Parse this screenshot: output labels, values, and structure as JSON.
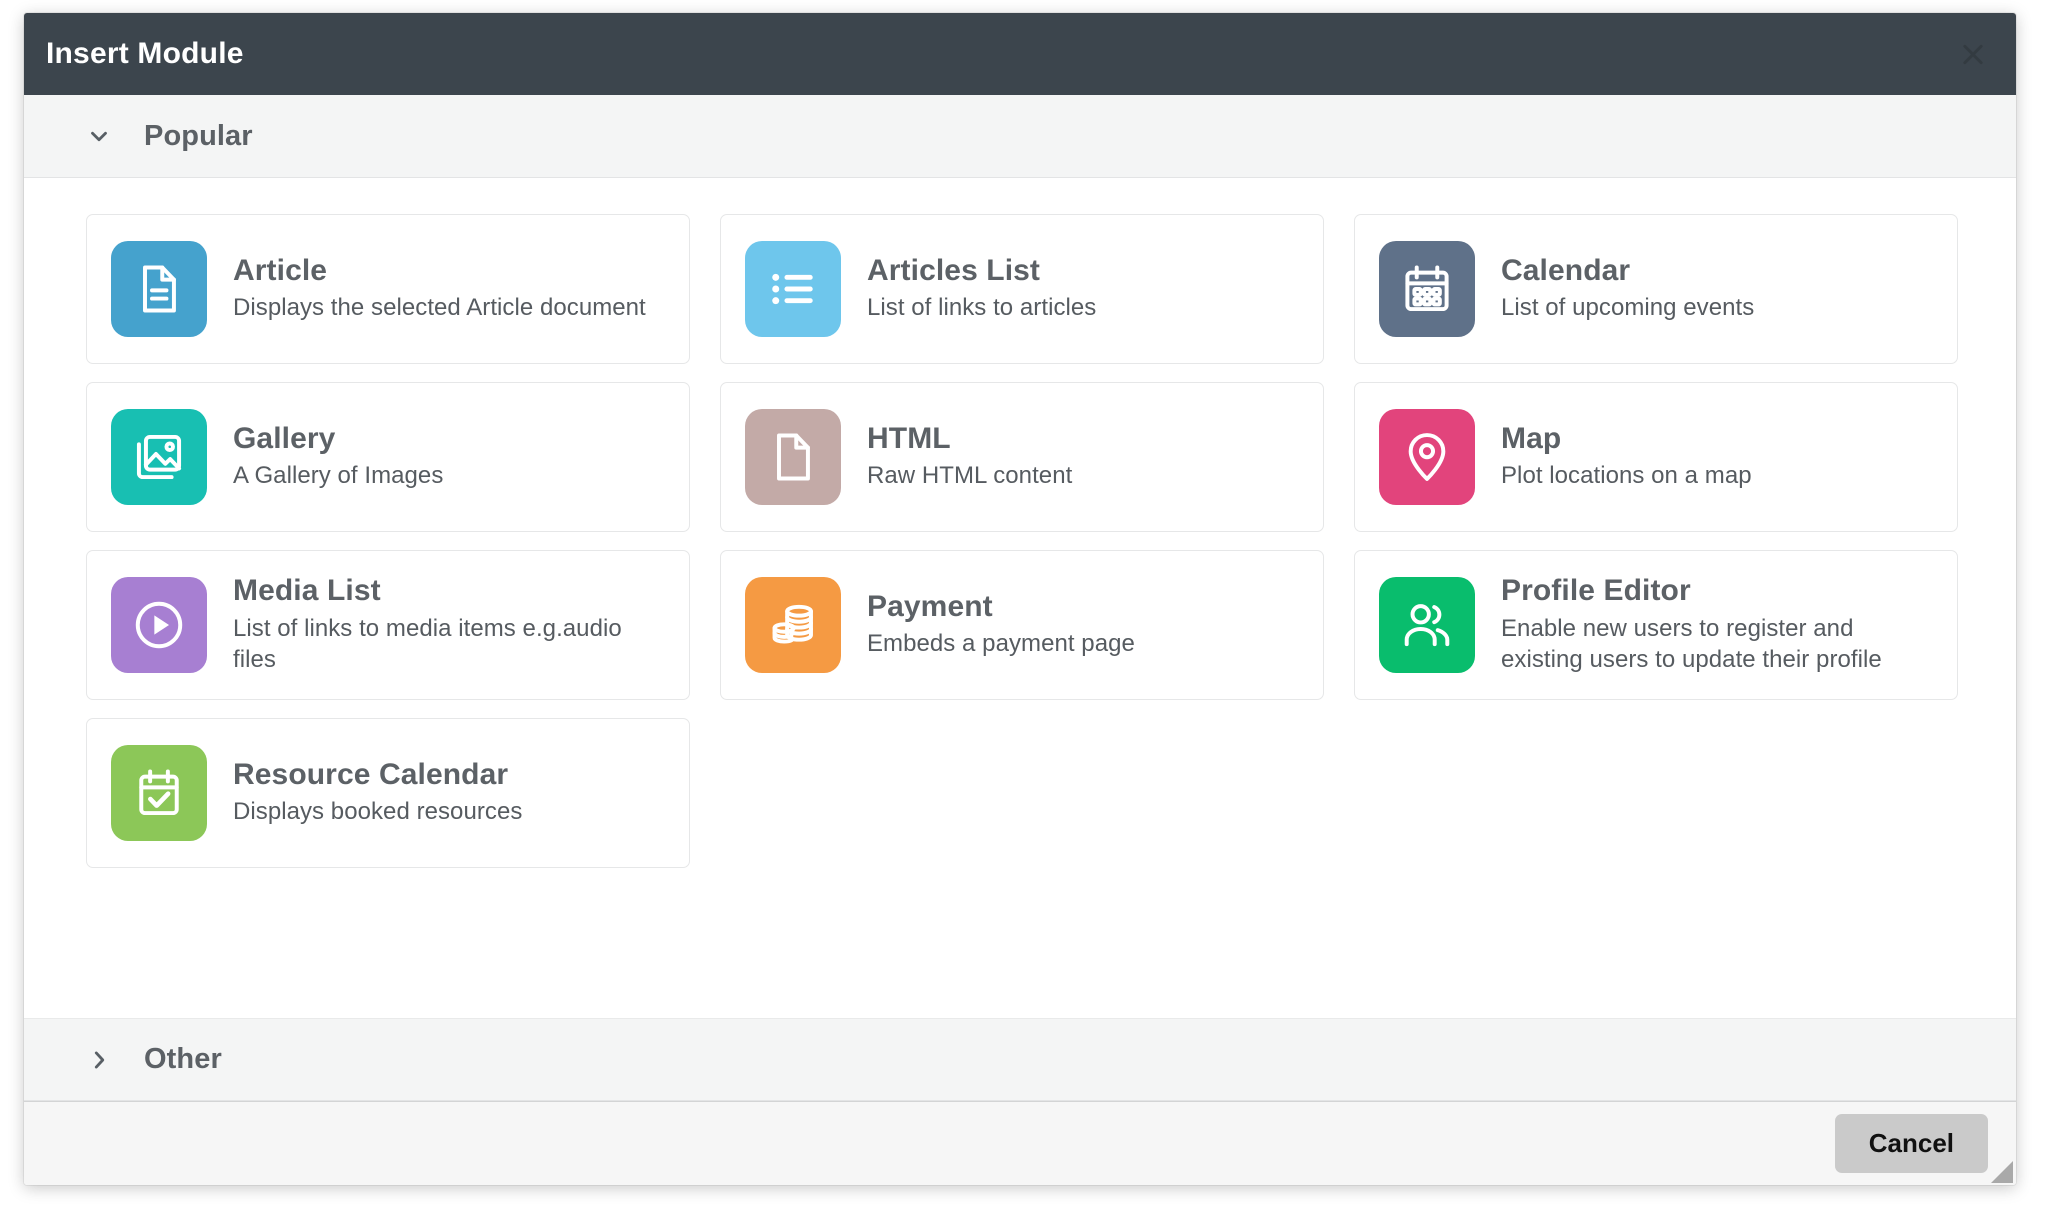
{
  "window": {
    "title": "Insert Module",
    "close_icon": "close-icon"
  },
  "sections": [
    {
      "id": "popular",
      "label": "Popular",
      "expanded": true,
      "chevron_icon": "chevron-down-icon"
    },
    {
      "id": "other",
      "label": "Other",
      "expanded": false,
      "chevron_icon": "chevron-right-icon"
    }
  ],
  "modules": [
    {
      "title": "Article",
      "description": "Displays the selected Article document",
      "icon": "document-lines-icon",
      "color": "#45A2CD"
    },
    {
      "title": "Articles List",
      "description": "List of links to articles",
      "icon": "bulleted-list-icon",
      "color": "#6EC6EC"
    },
    {
      "title": "Calendar",
      "description": "List of upcoming events",
      "icon": "calendar-icon",
      "color": "#5F7189"
    },
    {
      "title": "Gallery",
      "description": "A Gallery of Images",
      "icon": "images-stack-icon",
      "color": "#18BFB2"
    },
    {
      "title": "HTML",
      "description": "Raw HTML content",
      "icon": "blank-page-icon",
      "color": "#C3AAA7"
    },
    {
      "title": "Map",
      "description": "Plot locations on a map",
      "icon": "map-pin-icon",
      "color": "#E2447C"
    },
    {
      "title": "Media List",
      "description": "List of links to media items e.g.audio files",
      "icon": "play-circle-icon",
      "color": "#A77FD2"
    },
    {
      "title": "Payment",
      "description": "Embeds a payment page",
      "icon": "coins-stack-icon",
      "color": "#F59A43"
    },
    {
      "title": "Profile Editor",
      "description": "Enable new users to register and existing users to update their profile",
      "icon": "users-pair-icon",
      "color": "#09BD6D"
    },
    {
      "title": "Resource Calendar",
      "description": "Displays booked resources",
      "icon": "calendar-check-icon",
      "color": "#8CC758"
    }
  ],
  "footer": {
    "cancel_label": "Cancel",
    "resize_grip_icon": "resize-grip-icon"
  }
}
